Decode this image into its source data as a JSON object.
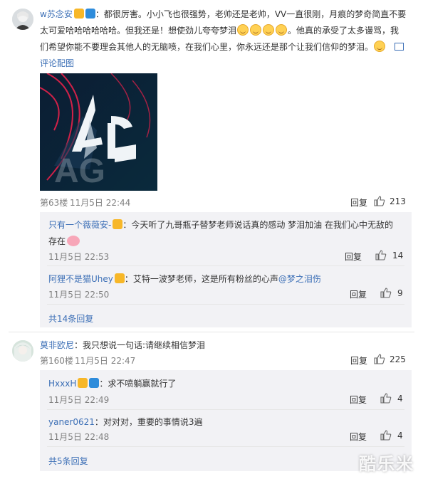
{
  "comments": [
    {
      "user": "w苏念安",
      "text_part1": "：都很厉害。小小飞也很强势，老帅还是老帅，VV一直很刚，月痕的梦奇简直不要",
      "text_part2": "太可爱哈哈哈哈哈哈。但我还是！想使劲儿夸夸梦泪",
      "text_part3": "。他真的承受了太多谩骂，我",
      "text_part4": "们希望你能不要理会其他人的无脑喷，在我们心里，你永远还是那个让我们信仰的梦泪。",
      "image_label": "评论配图",
      "image_text": "AG",
      "floor": "第63楼",
      "time": "11月5日 22:44",
      "reply_label": "回复",
      "likes": "213",
      "replies": [
        {
          "user": "只有一个薇薇安-",
          "text_part1": "：今天听了九哥瓶子替梦老师说话真的感动 梦泪加油 在我们心中无敌的",
          "text_part2": "存在",
          "time": "11月5日 22:53",
          "reply_label": "回复",
          "likes": "14"
        },
        {
          "user": "阿狸不是猫Uhey",
          "text": "：艾特一波梦老师，这是所有粉丝的心声",
          "mention": "@梦之泪伤",
          "time": "11月5日 22:50",
          "reply_label": "回复",
          "likes": "9"
        }
      ],
      "more": "共14条回复"
    },
    {
      "user": "莫非欧尼",
      "text": "：我只想说一句话:请继续相信梦泪",
      "floor": "第160楼",
      "time": "11月5日 22:47",
      "reply_label": "回复",
      "likes": "225",
      "replies": [
        {
          "user": "HxxxH",
          "text": "：求不喷躺赢就行了",
          "time": "11月5日 22:49",
          "reply_label": "回复",
          "likes": "4"
        },
        {
          "user": "yaner0621",
          "text": "：对对对，重要的事情说3遍",
          "time": "11月5日 22:48",
          "reply_label": "回复",
          "likes": "4"
        }
      ],
      "more": "共5条回复"
    }
  ],
  "watermark": "酷乐米",
  "colors": {
    "link": "#eb7350",
    "name": "#3c6fb6",
    "reply_bg": "#f2f2f5"
  }
}
